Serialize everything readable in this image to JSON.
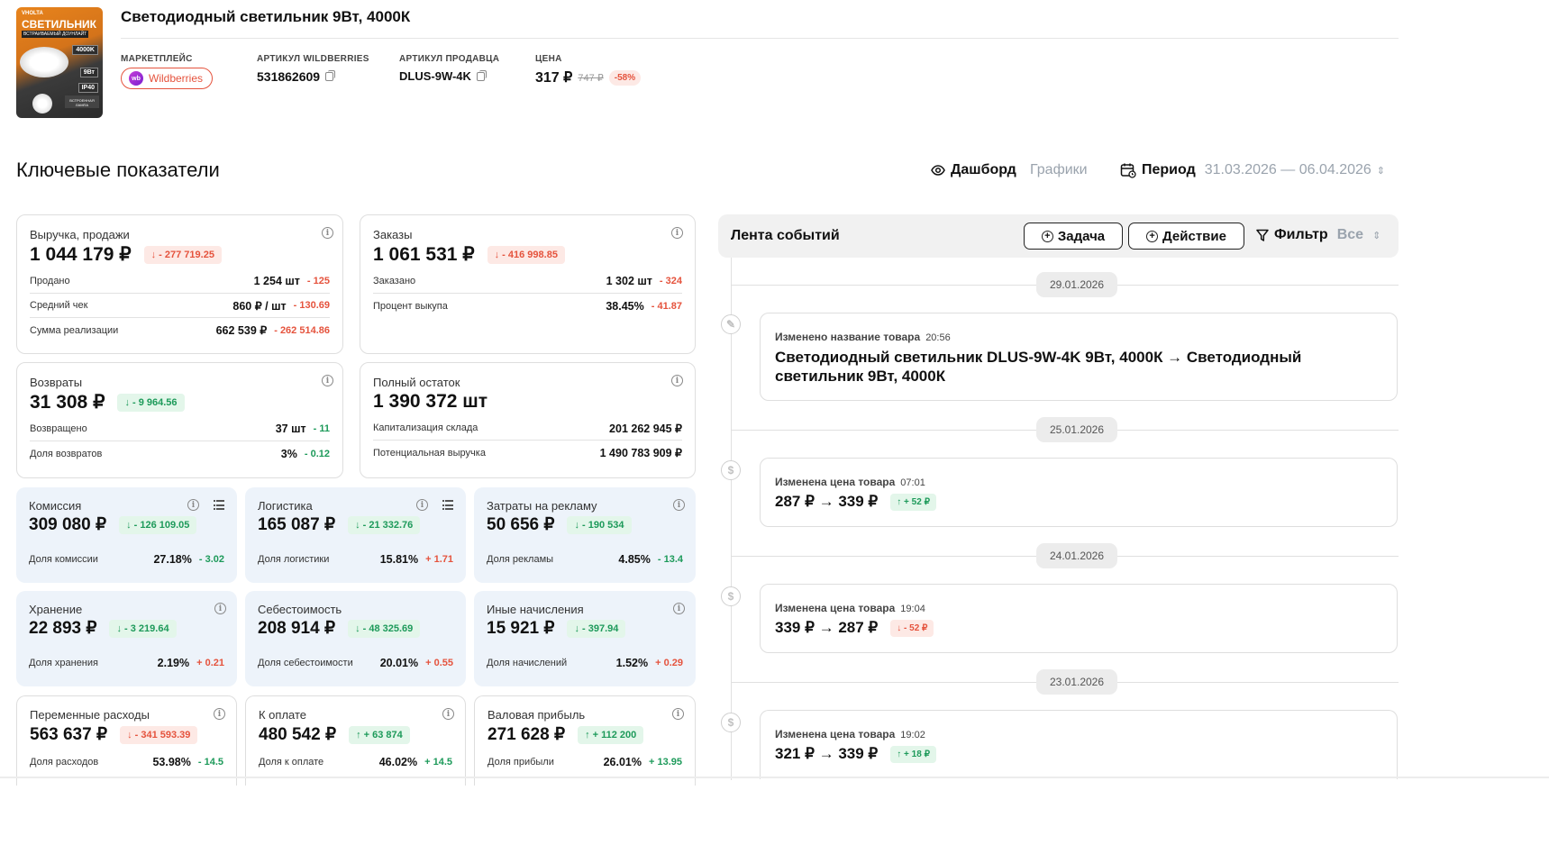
{
  "product": {
    "image": {
      "brand": "VHOLTA",
      "title": "СВЕТИЛЬНИК",
      "subtitle": "ВСТРАИВАЕМЫЙ ДОУНЛАЙТ",
      "tags": [
        "4000K",
        "9Вт",
        "IP40"
      ],
      "box_label": "ВСТРОЕННАЯ ЛАМПА"
    },
    "title": "Светодиодный светильник 9Вт, 4000К",
    "marketplace_label": "МАРКЕТПЛЕЙС",
    "marketplace_icon": "wb",
    "marketplace": "Wildberries",
    "wb_article_label": "АРТИКУЛ WILDBERRIES",
    "wb_article": "531862609",
    "seller_article_label": "АРТИКУЛ ПРОДАВЦА",
    "seller_article": "DLUS-9W-4K",
    "price_label": "ЦЕНА",
    "price": "317 ₽",
    "old_price": "747 ₽",
    "discount": "-58%"
  },
  "section_title": "Ключевые показатели",
  "nav": {
    "dashboard": "Дашборд",
    "charts": "Графики",
    "period_label": "Период",
    "period": "31.03.2026 — 06.04.2026"
  },
  "colors": {
    "red": "#e5533d",
    "green": "#1d9a5a",
    "card_blue": "#edf3fa"
  },
  "cards": {
    "revenue": {
      "title": "Выручка, продажи",
      "value": "1 044 179 ₽",
      "delta": "↓ - 277 719.25",
      "rows": [
        {
          "label": "Продано",
          "value": "1 254 шт",
          "delta": "- 125"
        },
        {
          "label": "Средний чек",
          "value": "860 ₽ / шт",
          "delta": "- 130.69"
        },
        {
          "label": "Сумма реализации",
          "value": "662 539 ₽",
          "delta": "- 262 514.86"
        }
      ]
    },
    "orders": {
      "title": "Заказы",
      "value": "1 061 531 ₽",
      "delta": "↓ - 416 998.85",
      "rows": [
        {
          "label": "Заказано",
          "value": "1 302 шт",
          "delta": "- 324"
        },
        {
          "label": "Процент выкупа",
          "value": "38.45%",
          "delta": "- 41.87"
        }
      ]
    },
    "returns": {
      "title": "Возвраты",
      "value": "31 308 ₽",
      "delta": "↓ - 9 964.56",
      "rows": [
        {
          "label": "Возвращено",
          "value": "37 шт",
          "delta": "- 11"
        },
        {
          "label": "Доля возвратов",
          "value": "3%",
          "delta": "- 0.12"
        }
      ]
    },
    "stock": {
      "title": "Полный остаток",
      "value": "1 390 372 шт",
      "rows": [
        {
          "label": "Капитализация склада",
          "value": "201 262 945 ₽"
        },
        {
          "label": "Потенциальная выручка",
          "value": "1 490 783 909 ₽"
        }
      ]
    },
    "commission": {
      "title": "Комиссия",
      "value": "309 080 ₽",
      "delta": "↓ - 126 109.05",
      "row": {
        "label": "Доля комиссии",
        "value": "27.18%",
        "delta": "- 3.02"
      }
    },
    "logistics": {
      "title": "Логистика",
      "value": "165 087 ₽",
      "delta": "↓ - 21 332.76",
      "row": {
        "label": "Доля логистики",
        "value": "15.81%",
        "delta": "+ 1.71"
      }
    },
    "ads": {
      "title": "Затраты на рекламу",
      "value": "50 656 ₽",
      "delta": "↓ - 190 534",
      "row": {
        "label": "Доля рекламы",
        "value": "4.85%",
        "delta": "- 13.4"
      }
    },
    "storage": {
      "title": "Хранение",
      "value": "22 893 ₽",
      "delta": "↓ - 3 219.64",
      "row": {
        "label": "Доля хранения",
        "value": "2.19%",
        "delta": "+ 0.21"
      }
    },
    "cost": {
      "title": "Себестоимость",
      "value": "208 914 ₽",
      "delta": "↓ - 48 325.69",
      "row": {
        "label": "Доля себестоимости",
        "value": "20.01%",
        "delta": "+ 0.55"
      }
    },
    "other": {
      "title": "Иные начисления",
      "value": "15 921 ₽",
      "delta": "↓ - 397.94",
      "row": {
        "label": "Доля начислений",
        "value": "1.52%",
        "delta": "+ 0.29"
      }
    },
    "variable": {
      "title": "Переменные расходы",
      "value": "563 637 ₽",
      "delta": "↓ - 341 593.39",
      "row": {
        "label": "Доля расходов",
        "value": "53.98%",
        "delta": "- 14.5"
      }
    },
    "payout": {
      "title": "К оплате",
      "value": "480 542 ₽",
      "delta": "↑ + 63 874",
      "row": {
        "label": "Доля к оплате",
        "value": "46.02%",
        "delta": "+ 14.5"
      }
    },
    "gross": {
      "title": "Валовая прибыль",
      "value": "271 628 ₽",
      "delta": "↑ + 112 200",
      "row": {
        "label": "Доля прибыли",
        "value": "26.01%",
        "delta": "+ 13.95"
      }
    }
  },
  "feed": {
    "title": "Лента событий",
    "task_btn": "Задача",
    "action_btn": "Действие",
    "filter_label": "Фильтр",
    "filter_value": "Все",
    "groups": [
      {
        "date": "29.01.2026",
        "event": {
          "title": "Изменено название товара",
          "time": "20:56",
          "body": "Светодиодный светильник DLUS-9W-4K 9Вт, 4000К → Светодиодный светильник 9Вт, 4000К"
        }
      },
      {
        "date": "25.01.2026",
        "event": {
          "title": "Изменена цена товара",
          "time": "07:01",
          "body": "287 ₽ → 339 ₽",
          "delta": "↑ + 52 ₽"
        }
      },
      {
        "date": "24.01.2026",
        "event": {
          "title": "Изменена цена товара",
          "time": "19:04",
          "body": "339 ₽ → 287 ₽",
          "delta": "↓ - 52 ₽"
        }
      },
      {
        "date": "23.01.2026",
        "event": {
          "title": "Изменена цена товара",
          "time": "19:02",
          "body": "321 ₽ → 339 ₽",
          "delta": "↑ + 18 ₽"
        }
      }
    ]
  }
}
